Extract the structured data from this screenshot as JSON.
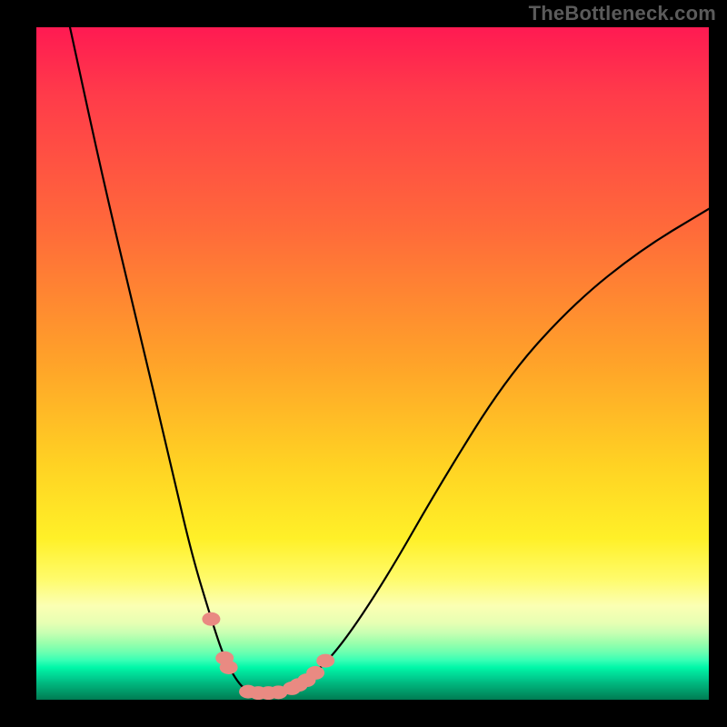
{
  "watermark": "TheBottleneck.com",
  "chart_data": {
    "type": "line",
    "title": "",
    "xlabel": "",
    "ylabel": "",
    "xlim": [
      0,
      100
    ],
    "ylim": [
      0,
      100
    ],
    "series": [
      {
        "name": "curve",
        "x": [
          5,
          10,
          15,
          20,
          23,
          26,
          28,
          30,
          31.5,
          33,
          35,
          37,
          40,
          45,
          52,
          60,
          70,
          80,
          90,
          100
        ],
        "values": [
          100,
          77,
          56,
          35,
          22,
          12,
          6,
          2.5,
          1.2,
          1,
          1,
          1.2,
          2.6,
          7.5,
          18,
          32,
          48,
          59,
          67,
          73
        ]
      }
    ],
    "markers": [
      {
        "x": 26,
        "y": 12
      },
      {
        "x": 28,
        "y": 6.2
      },
      {
        "x": 28.6,
        "y": 4.8
      },
      {
        "x": 31.5,
        "y": 1.2
      },
      {
        "x": 33,
        "y": 1.0
      },
      {
        "x": 34.5,
        "y": 1.0
      },
      {
        "x": 36,
        "y": 1.1
      },
      {
        "x": 38,
        "y": 1.7
      },
      {
        "x": 39,
        "y": 2.2
      },
      {
        "x": 40.2,
        "y": 2.9
      },
      {
        "x": 41.5,
        "y": 4.0
      },
      {
        "x": 43,
        "y": 5.8
      }
    ]
  }
}
